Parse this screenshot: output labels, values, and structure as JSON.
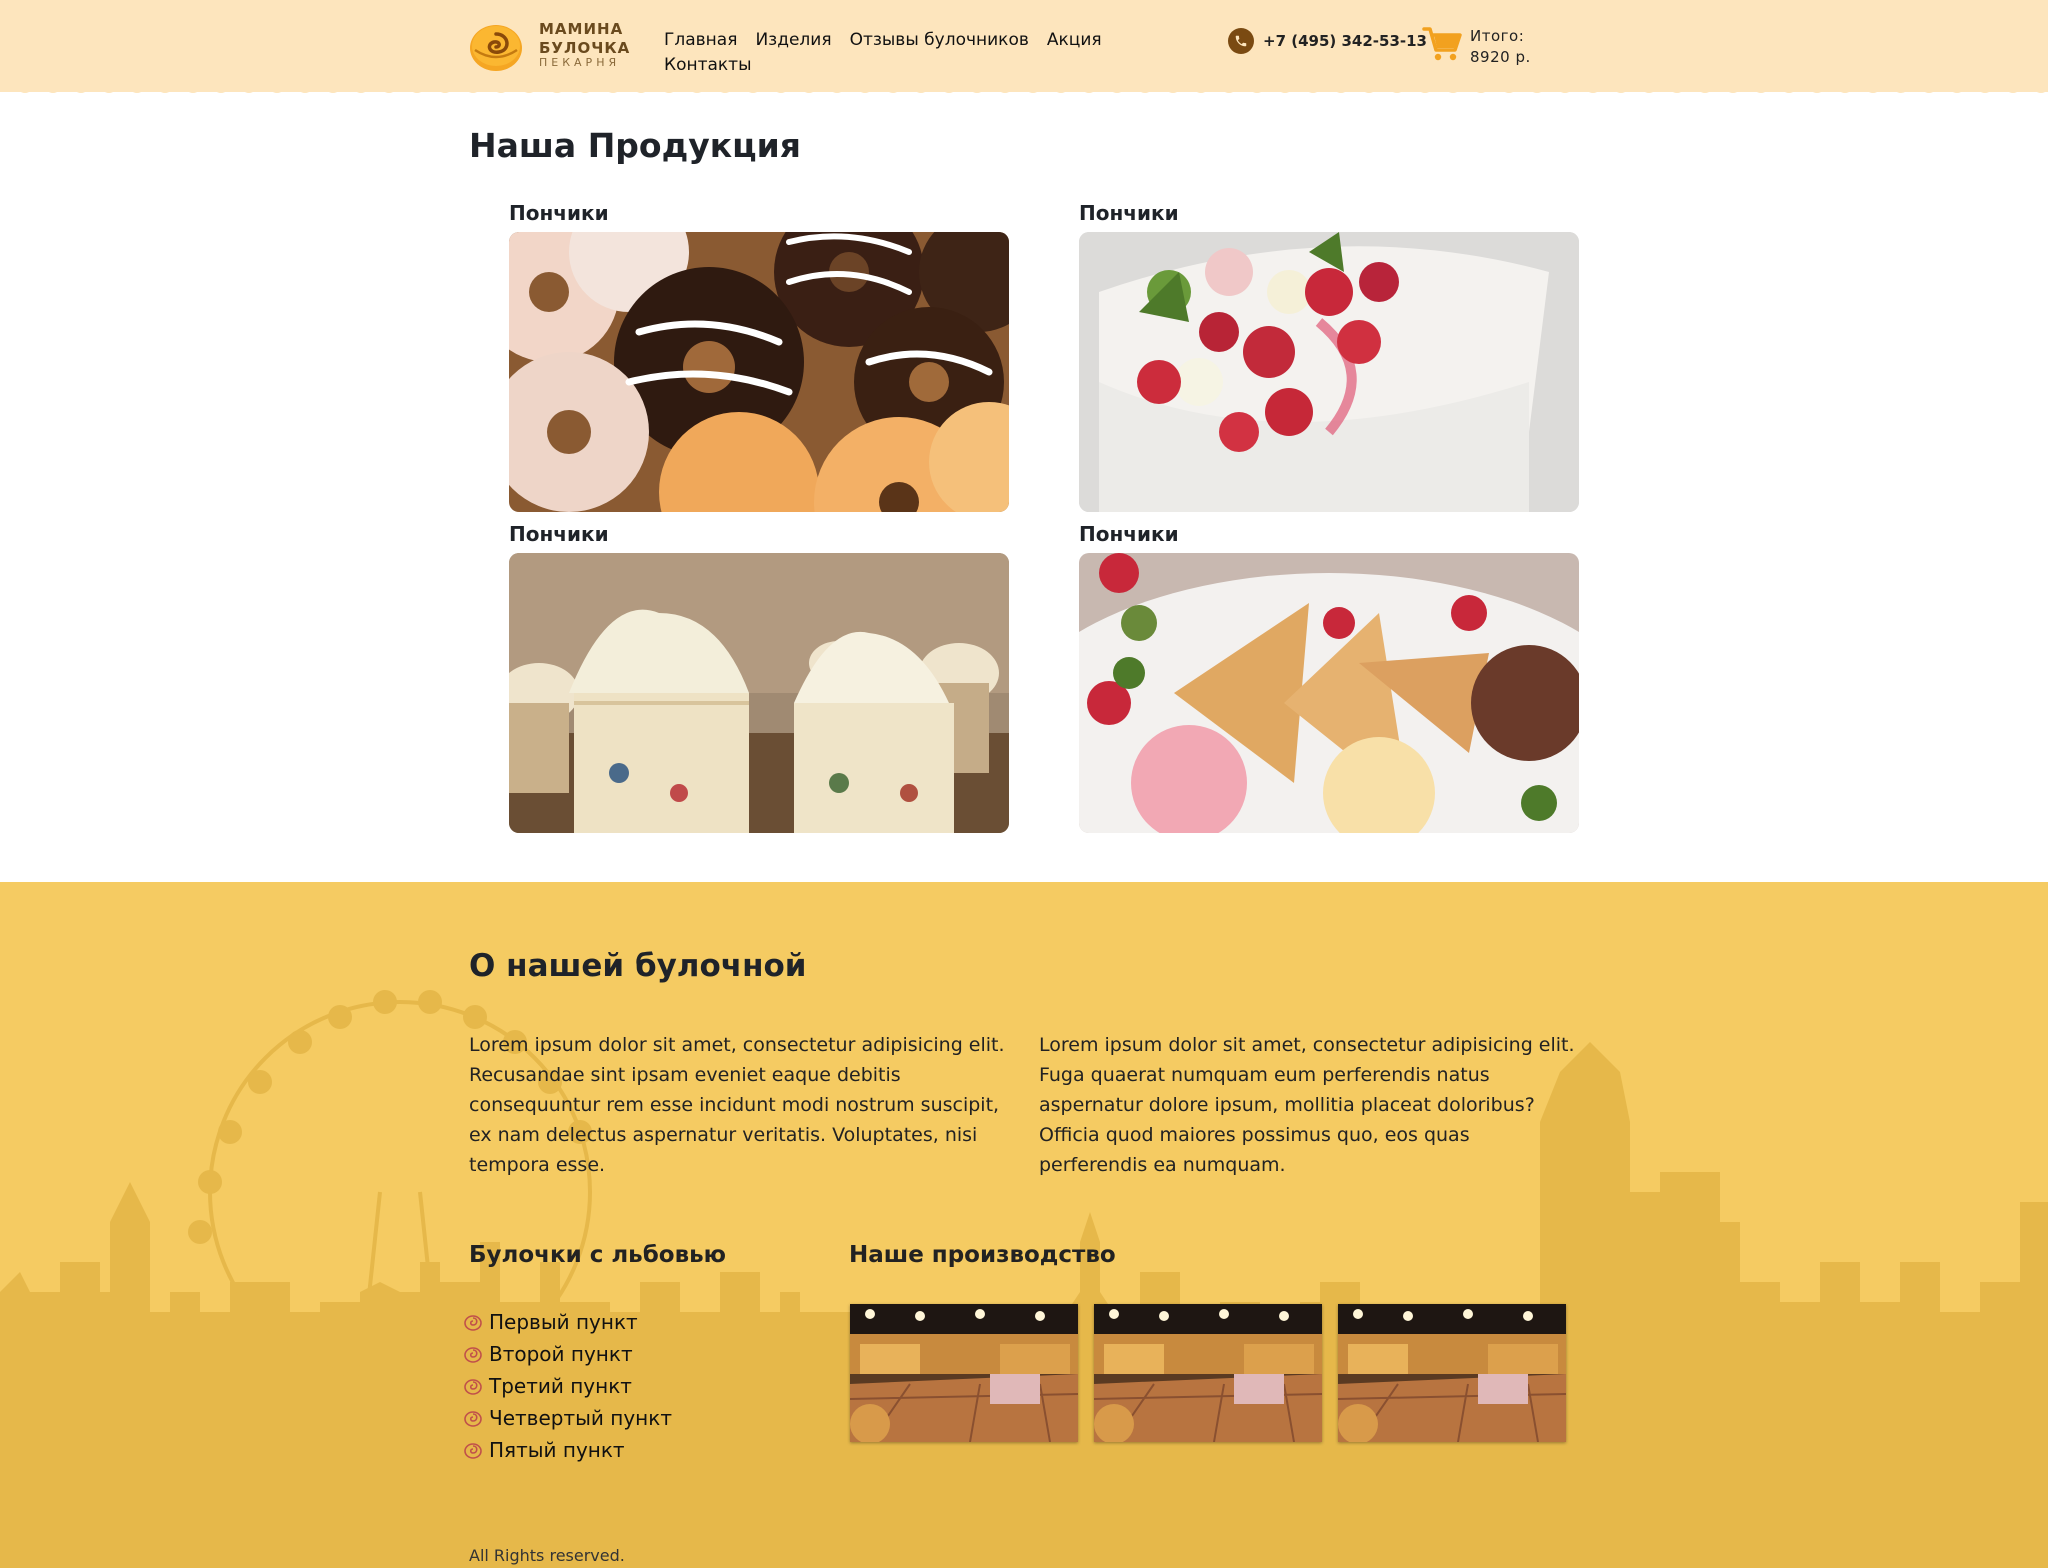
{
  "brand": {
    "name_line1": "МАМИНА",
    "name_line2": "БУЛОЧКА",
    "tagline": "ПЕКАРНЯ"
  },
  "nav": {
    "items": [
      {
        "label": "Главная"
      },
      {
        "label": "Изделия"
      },
      {
        "label": "Отзывы булочников"
      },
      {
        "label": "Акция"
      },
      {
        "label": "Контакты"
      }
    ]
  },
  "header": {
    "phone": "+7 (495) 342-53-13",
    "cart_label": "Итого:",
    "cart_total": "8920 р."
  },
  "products": {
    "title": "Наша Продукция",
    "items": [
      {
        "title": "Пончики",
        "image": "donuts"
      },
      {
        "title": "Пончики",
        "image": "berry-cake"
      },
      {
        "title": "Пончики",
        "image": "cupcakes"
      },
      {
        "title": "Пончики",
        "image": "ice-cream-cones"
      }
    ]
  },
  "about": {
    "title": "О нашей булочной",
    "text_left": "Lorem ipsum dolor sit amet, consectetur adipisicing elit. Recusandae sint ipsam eveniet eaque debitis consequuntur rem esse incidunt modi nostrum suscipit, ex nam delectus aspernatur veritatis. Voluptates, nisi tempora esse.",
    "text_right": "Lorem ipsum dolor sit amet, consectetur adipisicing elit. Fuga quaerat numquam eum perferendis natus aspernatur dolore ipsum, mollitia placeat doloribus? Officia quod maiores possimus quo, eos quas perferendis ea numquam.",
    "list_title": "Булочки с льбовью",
    "list": [
      "Первый пункт",
      "Второй пункт",
      "Третий пункт",
      "Четвертый пункт",
      "Пятый пункт"
    ],
    "production_title": "Наше производство",
    "production_images": [
      "bakery-interior",
      "bakery-interior",
      "bakery-interior"
    ]
  },
  "footer": {
    "copyright": "All Rights reserved."
  },
  "colors": {
    "header_bg": "#fde5bd",
    "about_bg": "#f5cb62",
    "skyline": "#e6b84a",
    "brand_brown": "#7a4a12",
    "cart_orange": "#f2a11f"
  }
}
